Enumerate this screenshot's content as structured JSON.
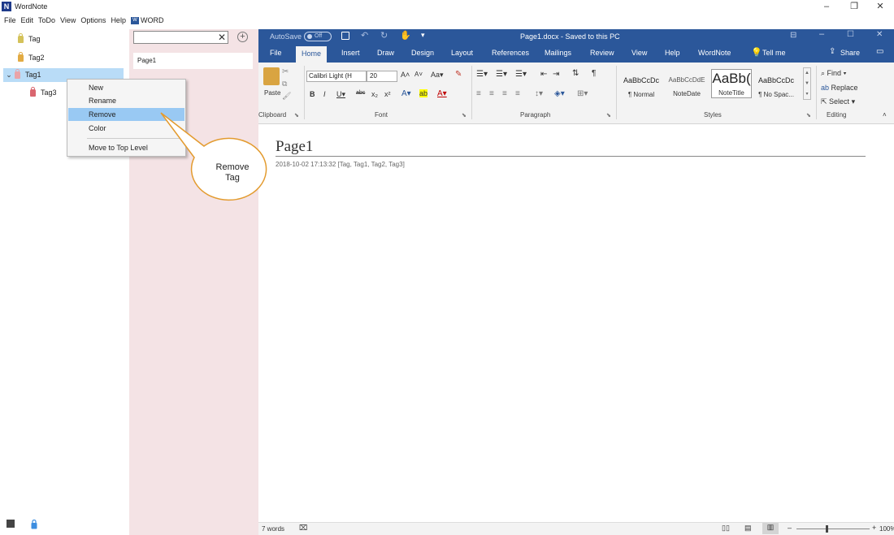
{
  "window": {
    "title": "WordNote",
    "logo_letter": "N",
    "controls": {
      "minimize": "–",
      "restore": "❐",
      "close": "✕"
    }
  },
  "menubar": {
    "items": [
      "File",
      "Edit",
      "ToDo",
      "View",
      "Options",
      "Help"
    ],
    "word_label": "WORD"
  },
  "tags": [
    {
      "label": "Tag",
      "color": "#d4c25a"
    },
    {
      "label": "Tag2",
      "color": "#e2ab43"
    },
    {
      "label": "Tag1",
      "color": "#e9a3a8",
      "expanded": true,
      "selected": true
    },
    {
      "label": "Tag3",
      "color": "#d9666f"
    }
  ],
  "pages": {
    "search_placeholder": "",
    "items": [
      "Page1"
    ]
  },
  "context_menu": {
    "items": [
      "New",
      "Rename",
      "Remove",
      "Color",
      "Move to Top Level"
    ],
    "highlighted": "Remove"
  },
  "callout": {
    "text": "Remove\nTag"
  },
  "word": {
    "autosave": "AutoSave",
    "autosave_state": "Off",
    "doc_title": "Page1.docx - Saved to this PC",
    "tabs": [
      "File",
      "Home",
      "Insert",
      "Draw",
      "Design",
      "Layout",
      "References",
      "Mailings",
      "Review",
      "View",
      "Help",
      "WordNote",
      "Tell me"
    ],
    "active_tab": "Home",
    "share": "Share",
    "ribbon": {
      "groups": [
        "Clipboard",
        "Font",
        "Paragraph",
        "Styles",
        "Editing"
      ],
      "paste": "Paste",
      "font_name": "Calibri Light (H",
      "font_size": "20",
      "styles": [
        {
          "sample": "AaBbCcDc",
          "name": "¶ Normal"
        },
        {
          "sample": "AaBbCcDdE",
          "name": "NoteDate"
        },
        {
          "sample": "AaBb(",
          "name": "NoteTitle"
        },
        {
          "sample": "AaBbCcDc",
          "name": "¶ No Spac..."
        }
      ],
      "editing": [
        "Find",
        "Replace",
        "Select"
      ]
    },
    "document": {
      "title": "Page1",
      "meta": "2018-10-02 17:13:32  [Tag, Tag1, Tag2, Tag3]"
    },
    "status": {
      "words": "7 words",
      "zoom": "100%"
    }
  }
}
